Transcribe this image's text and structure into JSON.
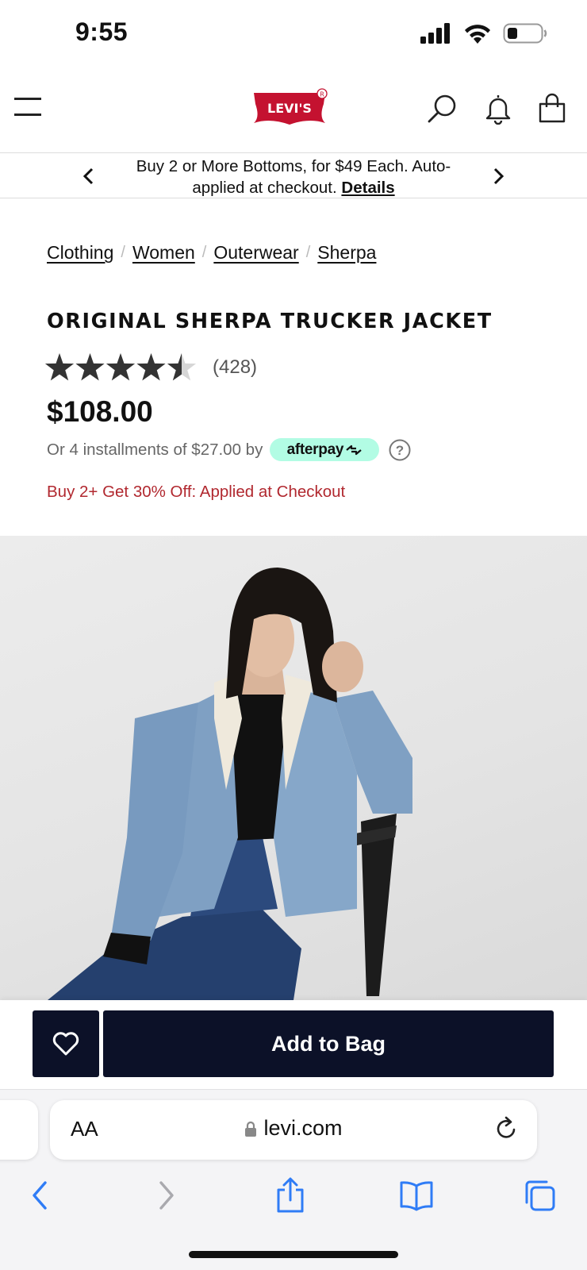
{
  "status_bar": {
    "time": "9:55"
  },
  "header": {
    "logo_text": "LEVI'S"
  },
  "promo": {
    "text": "Buy 2 or More Bottoms, for $49 Each. Auto-applied at checkout.",
    "link_label": "Details"
  },
  "breadcrumb": {
    "items": [
      {
        "label": "Clothing"
      },
      {
        "label": "Women"
      },
      {
        "label": "Outerwear"
      },
      {
        "label": "Sherpa"
      }
    ],
    "separator": "/"
  },
  "product": {
    "title": "ORIGINAL SHERPA TRUCKER JACKET",
    "rating": 4.5,
    "rating_max": 5,
    "review_count": "(428)",
    "price": "$108.00",
    "installments_text": "Or 4 installments of $27.00 by",
    "afterpay_label": "afterpay",
    "promotion": "Buy 2+ Get 30% Off: Applied at Checkout"
  },
  "actions": {
    "add_to_bag_label": "Add to Bag"
  },
  "browser": {
    "aa_label": "AA",
    "url": "levi.com"
  },
  "colors": {
    "brand_red": "#c41230",
    "button_navy": "#0c1128",
    "promo_red": "#b1282f",
    "afterpay_mint": "#b2fce4",
    "ios_blue": "#2f7cf6"
  }
}
